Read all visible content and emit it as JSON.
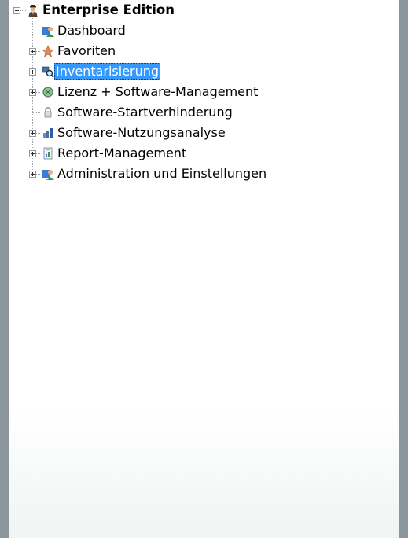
{
  "tree": {
    "root": {
      "label": "Enterprise Edition",
      "icon": "agent-person-icon",
      "expanded": true
    },
    "items": [
      {
        "label": "Dashboard",
        "icon": "dashboard-user-icon",
        "has_children": false,
        "selected": false
      },
      {
        "label": "Favoriten",
        "icon": "favorites-star-icon",
        "has_children": true,
        "selected": false
      },
      {
        "label": "Inventarisierung",
        "icon": "inventory-magnifier-icon",
        "has_children": true,
        "selected": true
      },
      {
        "label": "Lizenz + Software-Management",
        "icon": "license-globe-icon",
        "has_children": true,
        "selected": false
      },
      {
        "label": "Software-Startverhinderung",
        "icon": "lock-icon",
        "has_children": false,
        "selected": false
      },
      {
        "label": "Software-Nutzungsanalyse",
        "icon": "usage-analysis-icon",
        "has_children": true,
        "selected": false
      },
      {
        "label": "Report-Management",
        "icon": "report-document-icon",
        "has_children": true,
        "selected": false
      },
      {
        "label": "Administration und Einstellungen",
        "icon": "admin-user-icon",
        "has_children": true,
        "selected": false
      }
    ],
    "colors": {
      "selection": "#3399ff",
      "window_frame": "#8a969c",
      "panel": "#ffffff"
    }
  }
}
